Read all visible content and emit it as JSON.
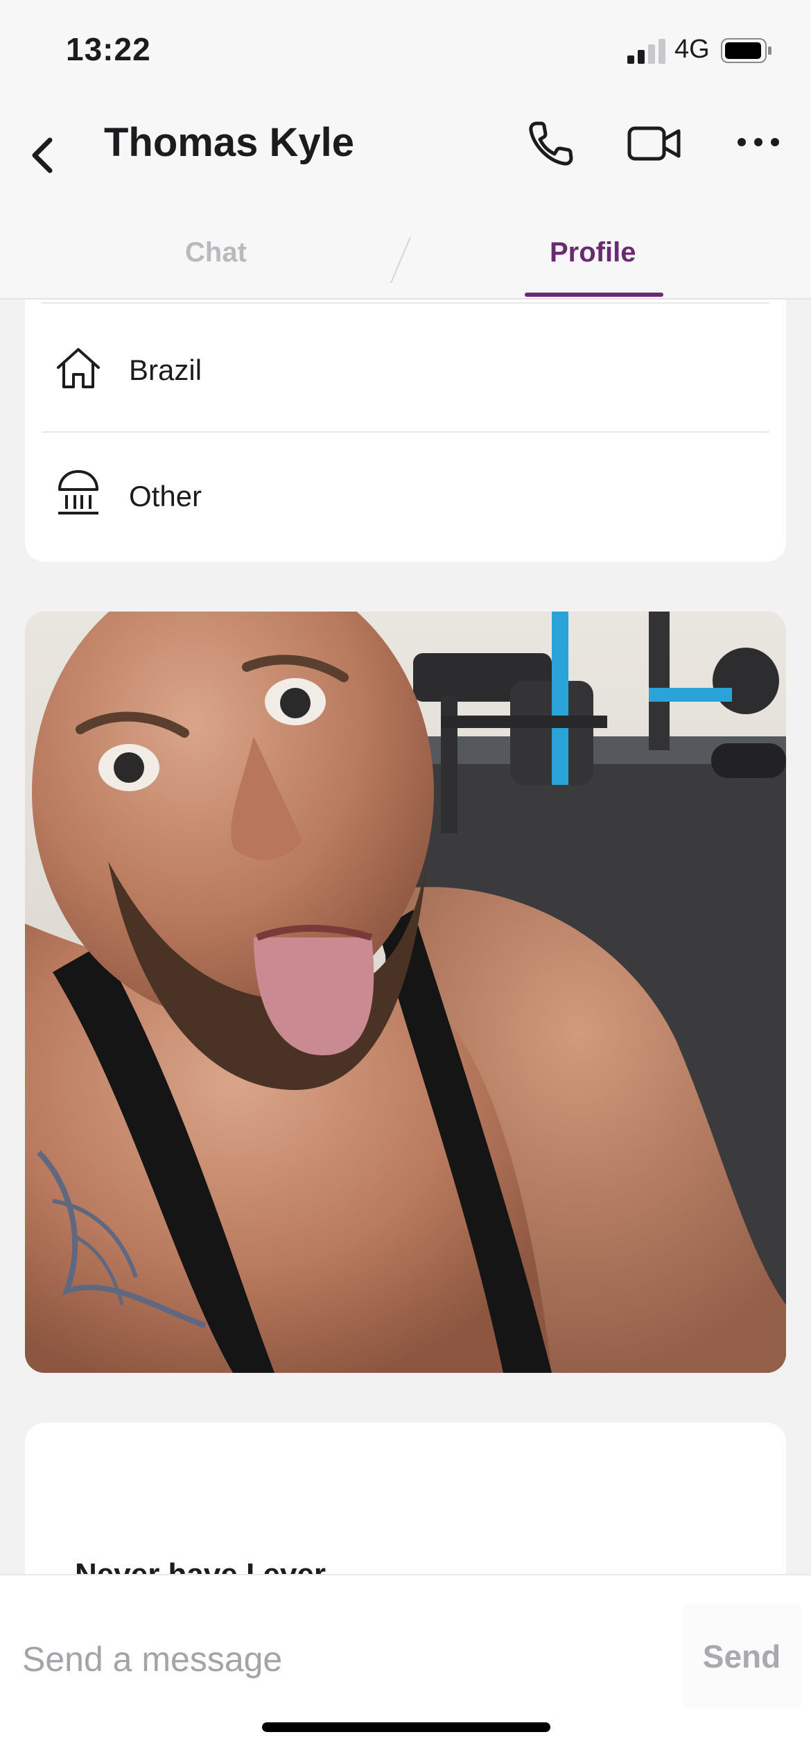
{
  "status_bar": {
    "time": "13:22",
    "network": "4G"
  },
  "header": {
    "title": "Thomas Kyle"
  },
  "tabs": [
    {
      "label": "Chat",
      "active": false
    },
    {
      "label": "Profile",
      "active": true
    }
  ],
  "profile_info": {
    "hometown": "Brazil",
    "education": "Other"
  },
  "photo": {
    "description": "man in black tank top taking selfie in gym"
  },
  "about": {
    "text": "Never have I ever"
  },
  "composer": {
    "placeholder": "Send a message",
    "send_label": "Send"
  },
  "colors": {
    "accent": "#6a2a72",
    "inactive_tab": "#b9b9be",
    "background": "#f2f2f3"
  }
}
